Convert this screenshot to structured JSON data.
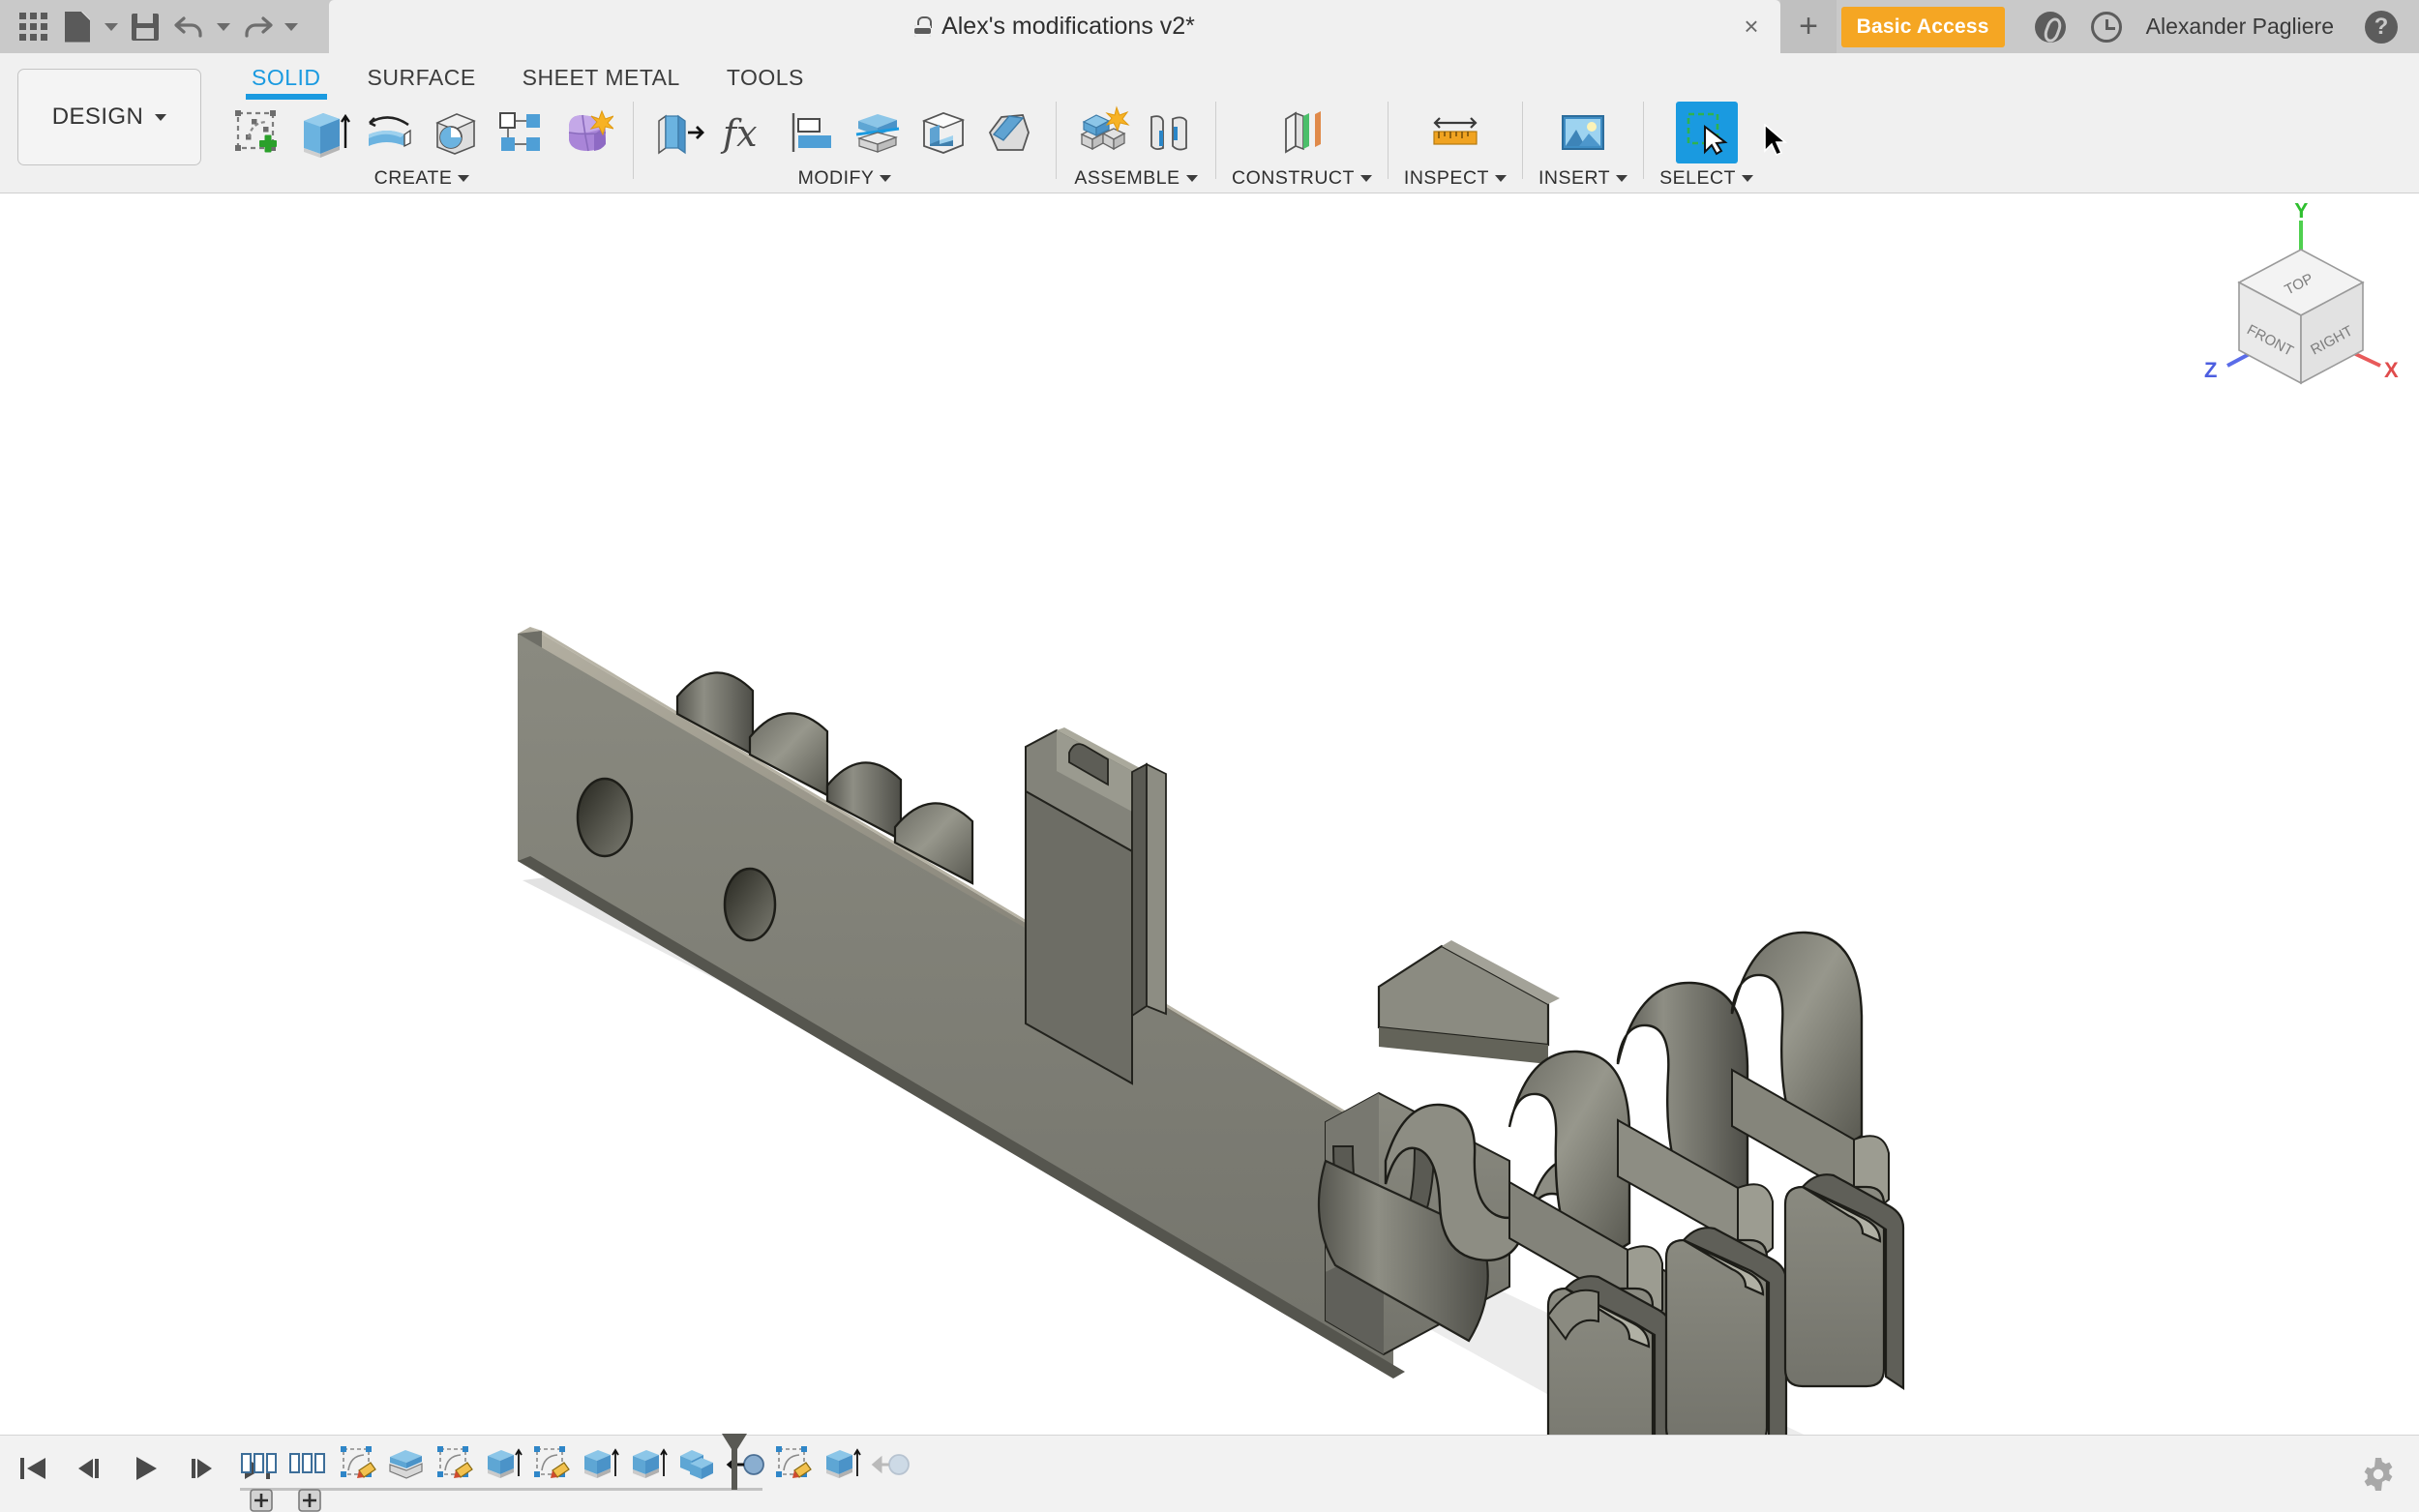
{
  "app": {
    "name": "Autodesk Fusion 360",
    "document_title": "Alex's modifications v2*",
    "locked": true,
    "account_badge": "Basic Access",
    "user_name": "Alexander Pagliere",
    "new_tab_label": "+",
    "close_tab_label": "×",
    "accent_color": "#1a9ae0",
    "badge_color": "#f5a623",
    "titlebar_color": "#c9c9c9",
    "ribbon_color": "#f0f0f0",
    "canvas_color": "#ffffff",
    "model_color": "#7a7a72"
  },
  "quick_access": [
    {
      "name": "app-grid-icon",
      "label": "Show Data Panel"
    },
    {
      "name": "file-icon",
      "label": "File"
    },
    {
      "name": "file-dropdown-caret",
      "label": "File menu"
    },
    {
      "name": "save-icon",
      "label": "Save"
    },
    {
      "name": "undo-icon",
      "label": "Undo"
    },
    {
      "name": "undo-dropdown-caret",
      "label": "Undo history"
    },
    {
      "name": "redo-icon",
      "label": "Redo"
    },
    {
      "name": "redo-dropdown-caret",
      "label": "Redo history"
    }
  ],
  "title_right": [
    {
      "name": "a360-status-icon",
      "label": "Autodesk 360 status"
    },
    {
      "name": "job-status-clock-icon",
      "label": "Job status"
    },
    {
      "name": "help-icon",
      "label": "Help"
    }
  ],
  "workspace": {
    "label": "DESIGN",
    "caret": "▼"
  },
  "ribbon_tabs": [
    {
      "label": "SOLID",
      "active": true
    },
    {
      "label": "SURFACE",
      "active": false
    },
    {
      "label": "SHEET METAL",
      "active": false
    },
    {
      "label": "TOOLS",
      "active": false
    }
  ],
  "panels": [
    {
      "label": "CREATE",
      "has_dropdown": true,
      "tools": [
        {
          "name": "create-sketch-icon",
          "label": "Create Sketch"
        },
        {
          "name": "extrude-icon",
          "label": "Extrude"
        },
        {
          "name": "revolve-icon",
          "label": "Revolve"
        },
        {
          "name": "sweep-icon",
          "label": "Sweep"
        },
        {
          "name": "pattern-icon",
          "label": "Rectangular Pattern"
        },
        {
          "name": "create-form-icon",
          "label": "Create Form"
        }
      ]
    },
    {
      "label": "MODIFY",
      "has_dropdown": true,
      "tools": [
        {
          "name": "press-pull-icon",
          "label": "Press Pull"
        },
        {
          "name": "change-parameters-icon",
          "label": "Change Parameters"
        },
        {
          "name": "align-icon",
          "label": "Align"
        },
        {
          "name": "split-body-icon",
          "label": "Split Body"
        },
        {
          "name": "shell-icon",
          "label": "Shell"
        },
        {
          "name": "chamfer-icon",
          "label": "Chamfer"
        }
      ]
    },
    {
      "label": "ASSEMBLE",
      "has_dropdown": true,
      "tools": [
        {
          "name": "new-component-icon",
          "label": "New Component"
        },
        {
          "name": "joint-icon",
          "label": "Joint"
        }
      ]
    },
    {
      "label": "CONSTRUCT",
      "has_dropdown": true,
      "tools": [
        {
          "name": "offset-plane-icon",
          "label": "Offset Plane"
        }
      ]
    },
    {
      "label": "INSPECT",
      "has_dropdown": true,
      "tools": [
        {
          "name": "measure-icon",
          "label": "Measure"
        }
      ]
    },
    {
      "label": "INSERT",
      "has_dropdown": true,
      "tools": [
        {
          "name": "insert-image-icon",
          "label": "Canvas / Insert Image"
        }
      ]
    },
    {
      "label": "SELECT",
      "has_dropdown": true,
      "tools": [
        {
          "name": "select-icon",
          "label": "Select",
          "selected": true
        }
      ]
    }
  ],
  "viewcube": {
    "faces": {
      "top": "TOP",
      "front": "FRONT",
      "right": "RIGHT"
    },
    "axes": [
      {
        "label": "X",
        "color": "#e85a5a"
      },
      {
        "label": "Y",
        "color": "#4fd04f"
      },
      {
        "label": "Z",
        "color": "#5a6ce8"
      }
    ]
  },
  "model": {
    "description": "Gray 3D CAD bracket with mounting holes and a spring-clip array",
    "body_color": "#7a7a72",
    "highlight_color": "#9a9a90",
    "shadow_color": "#4f4f49",
    "edge_color": "#1d1d1a",
    "ground_shadow": "#e6e6e6"
  },
  "timeline": {
    "playback": [
      {
        "name": "timeline-go-to-beginning-button",
        "label": "Go to beginning"
      },
      {
        "name": "timeline-step-back-button",
        "label": "Step back"
      },
      {
        "name": "timeline-play-button",
        "label": "Play"
      },
      {
        "name": "timeline-step-forward-button",
        "label": "Step forward"
      },
      {
        "name": "timeline-go-to-end-button",
        "label": "Go to end"
      }
    ],
    "features": [
      {
        "name": "timeline-feature-group-1",
        "icon": "feature-group-icon",
        "label": "Feature group"
      },
      {
        "name": "timeline-feature-group-2",
        "icon": "feature-group-icon",
        "label": "Feature group"
      },
      {
        "name": "timeline-feature-sketch-1",
        "icon": "sketch-icon",
        "label": "Sketch"
      },
      {
        "name": "timeline-feature-extrude-1",
        "icon": "extrude-thin-icon",
        "label": "Extrude"
      },
      {
        "name": "timeline-feature-sketch-2",
        "icon": "sketch-icon",
        "label": "Sketch"
      },
      {
        "name": "timeline-feature-extrude-2",
        "icon": "extrude-icon",
        "label": "Extrude"
      },
      {
        "name": "timeline-feature-sketch-3",
        "icon": "sketch-icon",
        "label": "Sketch"
      },
      {
        "name": "timeline-feature-extrude-3",
        "icon": "extrude-icon",
        "label": "Extrude"
      },
      {
        "name": "timeline-feature-extrude-4",
        "icon": "extrude-icon",
        "label": "Extrude"
      },
      {
        "name": "timeline-feature-combine",
        "icon": "combine-icon",
        "label": "Combine"
      },
      {
        "name": "timeline-feature-move-1",
        "icon": "move-copy-icon",
        "label": "Move/Copy"
      },
      {
        "name": "timeline-feature-sketch-4",
        "icon": "sketch-icon",
        "label": "Sketch"
      },
      {
        "name": "timeline-feature-extrude-5",
        "icon": "extrude-icon",
        "label": "Extrude"
      },
      {
        "name": "timeline-feature-move-2",
        "icon": "move-copy-icon-disabled",
        "label": "Move/Copy"
      }
    ],
    "marker_position_index": 12,
    "settings": {
      "name": "timeline-settings-gear-icon",
      "label": "Timeline settings"
    }
  }
}
